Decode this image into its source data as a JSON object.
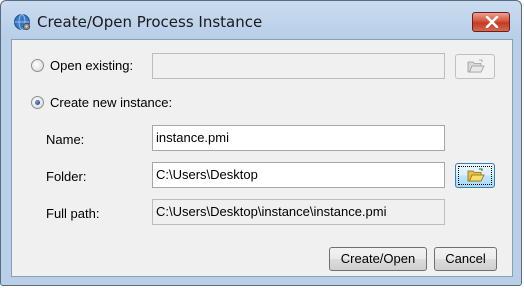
{
  "window": {
    "title": "Create/Open Process Instance"
  },
  "open_existing": {
    "label": "Open existing:",
    "selected": false,
    "path": ""
  },
  "create_new": {
    "label": "Create new instance:",
    "selected": true
  },
  "fields": {
    "name_label": "Name:",
    "name_value": "instance.pmi",
    "folder_label": "Folder:",
    "folder_value": "C:\\Users\\Desktop",
    "fullpath_label": "Full path:",
    "fullpath_value": "C:\\Users\\Desktop\\instance\\instance.pmi"
  },
  "buttons": {
    "create_open": "Create/Open",
    "cancel": "Cancel"
  },
  "icons": {
    "app": "globe-gear-icon",
    "close": "close-icon",
    "browse": "folder-open-icon"
  }
}
